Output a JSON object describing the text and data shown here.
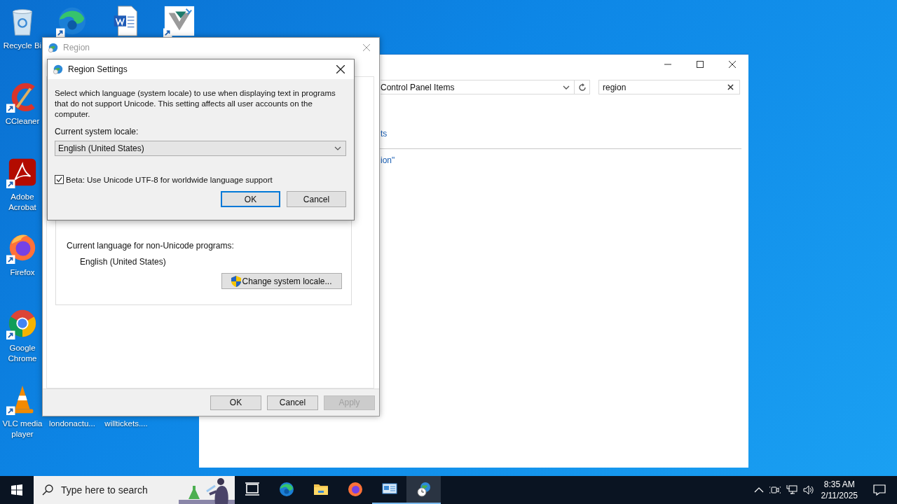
{
  "desktop": {
    "icons": [
      {
        "kind": "recycle-bin",
        "label": "Recycle Bi"
      },
      {
        "kind": "ccleaner",
        "label": "CCleaner"
      },
      {
        "kind": "acrobat",
        "label": "Adobe Acrobat"
      },
      {
        "kind": "firefox",
        "label": "Firefox"
      },
      {
        "kind": "chrome",
        "label": "Google Chrome"
      },
      {
        "kind": "vlc",
        "label": "VLC media player"
      },
      {
        "kind": "edge"
      },
      {
        "kind": "word-document"
      },
      {
        "kind": "installer"
      },
      {
        "label": "londonactu..."
      },
      {
        "label": "willtickets...."
      }
    ]
  },
  "control_panel": {
    "address": "Control Panel Items",
    "search": "region",
    "links": [
      "ts",
      "ion\""
    ]
  },
  "region_window": {
    "title": "Region",
    "active": false,
    "locale_label": "Current language for non-Unicode programs:",
    "locale_value": "English (United States)",
    "change_button": "Change system locale...",
    "buttons": [
      {
        "label": "OK",
        "disabled": false
      },
      {
        "label": "Cancel",
        "disabled": false
      },
      {
        "label": "Apply",
        "disabled": true
      }
    ]
  },
  "settings_dialog": {
    "title": "Region Settings",
    "active": true,
    "description": "Select which language (system locale) to use when displaying text in programs that do not support Unicode. This setting affects all user accounts on the computer.",
    "locale_label": "Current system locale:",
    "locale": "English (United States)",
    "beta": {
      "label": "Beta: Use Unicode UTF-8 for worldwide language support",
      "checked": true
    },
    "buttons": [
      {
        "label": "OK",
        "default": true
      },
      {
        "label": "Cancel",
        "default": false
      }
    ]
  },
  "taskbar": {
    "search_placeholder": "Type here to search",
    "apps": [
      {
        "kind": "task-view",
        "open": false,
        "selected": false
      },
      {
        "kind": "edge",
        "open": false,
        "selected": false
      },
      {
        "kind": "file-explorer",
        "open": false,
        "selected": false
      },
      {
        "kind": "firefox",
        "open": false,
        "selected": false
      },
      {
        "kind": "control-panel",
        "open": true,
        "selected": false
      },
      {
        "kind": "region",
        "open": true,
        "selected": true
      }
    ],
    "time": "8:35 AM",
    "date": "2/11/2025"
  }
}
